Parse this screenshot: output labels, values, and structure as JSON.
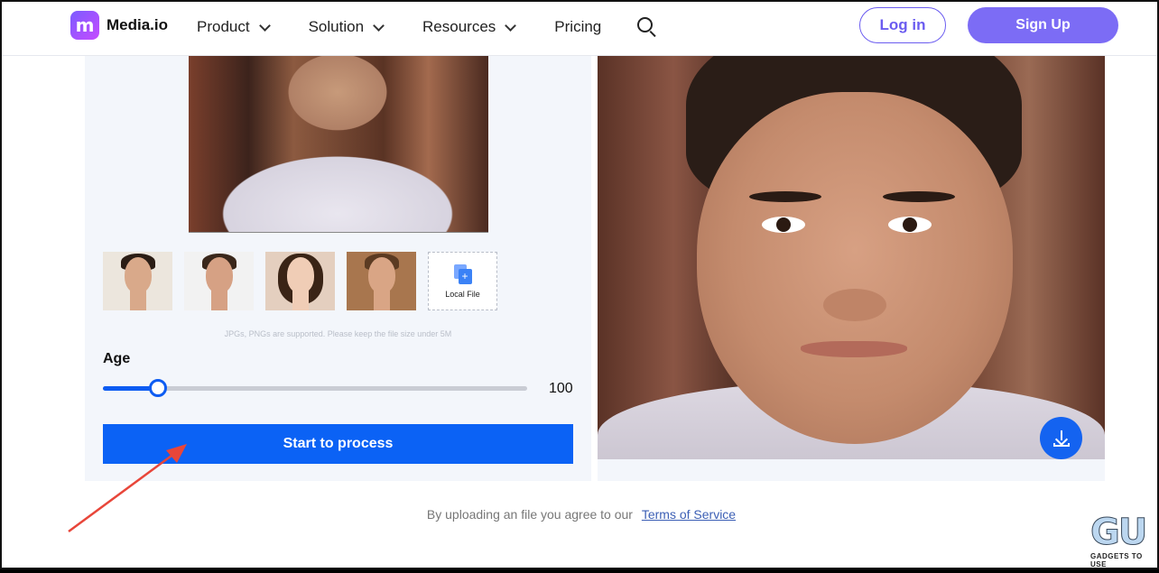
{
  "header": {
    "logo_glyph": "m",
    "logo_text": "Media.io",
    "nav": [
      {
        "label": "Product",
        "has_dropdown": true
      },
      {
        "label": "Solution",
        "has_dropdown": true
      },
      {
        "label": "Resources",
        "has_dropdown": true
      },
      {
        "label": "Pricing",
        "has_dropdown": false
      }
    ],
    "search_icon": "search-icon",
    "login_label": "Log in",
    "signup_label": "Sign Up"
  },
  "editor": {
    "sample_thumbnails": [
      "sample-man-1",
      "sample-man-2",
      "sample-woman",
      "sample-man-3"
    ],
    "local_file_label": "Local File",
    "hint": "JPGs, PNGs are supported. Please keep the file size under 5M",
    "age_label": "Age",
    "age_value": "100",
    "age_slider_fraction": 0.13,
    "process_label": "Start to process"
  },
  "result": {
    "download_icon": "download-icon"
  },
  "footer": {
    "agree_text": "By uploading an file you agree to our",
    "terms_link": "Terms of Service"
  },
  "watermark": {
    "logo": "GU",
    "tagline": "GADGETS TO USE"
  },
  "colors": {
    "brand_purple": "#7c6cf5",
    "primary_blue": "#0b62f5",
    "panel_bg": "#f3f6fb",
    "annotation_red": "#e8463a"
  }
}
